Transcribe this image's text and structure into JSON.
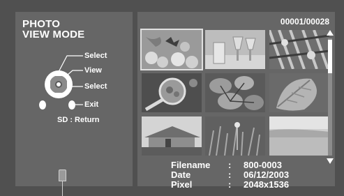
{
  "mode_title": [
    "PHOTO",
    "VIEW MODE"
  ],
  "controls": {
    "select_up": "Select",
    "view": "View",
    "select_down": "Select",
    "exit": "Exit",
    "sd_return": "SD : Return"
  },
  "counter": "00001/00028",
  "info": {
    "filename_label": "Filename",
    "filename_value": "800-0003",
    "date_label": "Date",
    "date_value": "06/12/2003",
    "pixel_label": "Pixel",
    "pixel_value": "2048x1536",
    "colon": ":"
  },
  "thumbnails": [
    {
      "name": "thumb-butterfly-flowers",
      "selected": true
    },
    {
      "name": "thumb-glasses",
      "selected": false
    },
    {
      "name": "thumb-fabric-pattern",
      "selected": false
    },
    {
      "name": "thumb-magnifier-stones",
      "selected": false
    },
    {
      "name": "thumb-leaves",
      "selected": false
    },
    {
      "name": "thumb-large-leaf",
      "selected": false
    },
    {
      "name": "thumb-hut",
      "selected": false
    },
    {
      "name": "thumb-grass",
      "selected": false
    },
    {
      "name": "thumb-beach",
      "selected": false
    }
  ],
  "scroll_position": 0.0
}
